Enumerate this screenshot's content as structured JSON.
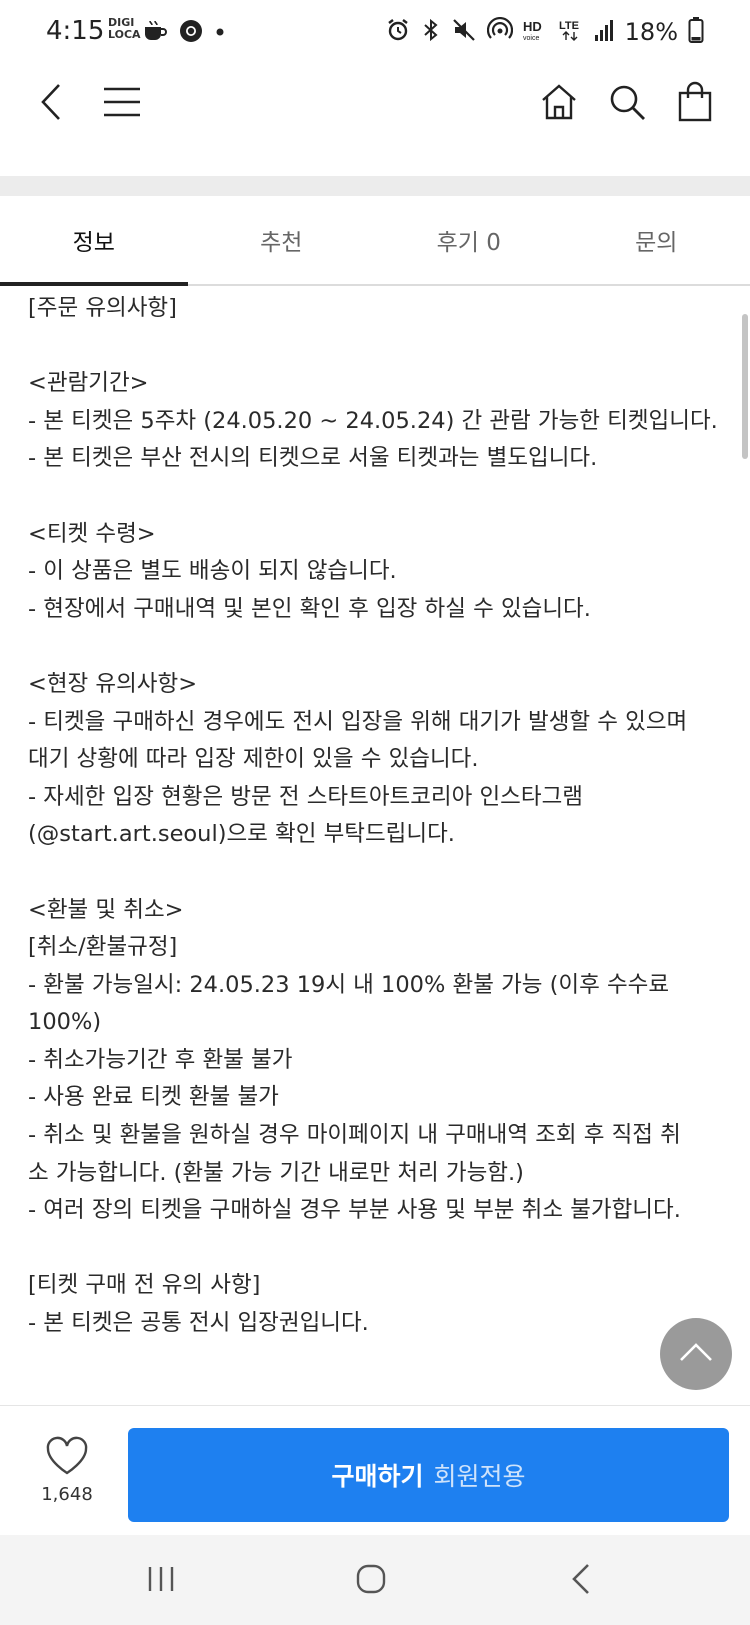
{
  "status_bar": {
    "time": "4:15",
    "app_badge": "DIGI LOCA",
    "battery_text": "18%",
    "icons": [
      "coffee-icon",
      "chrome-icon",
      "dot-icon",
      "alarm-icon",
      "bluetooth-icon",
      "mute-icon",
      "hotspot-icon",
      "hd-voice-icon",
      "lte-icon",
      "signal-icon",
      "battery-icon"
    ]
  },
  "top_nav": {
    "icons": [
      "back-icon",
      "menu-icon",
      "home-icon",
      "search-icon",
      "bag-icon"
    ]
  },
  "tabs": [
    {
      "label": "정보",
      "active": true
    },
    {
      "label": "추천",
      "active": false
    },
    {
      "label": "후기 0",
      "active": false
    },
    {
      "label": "문의",
      "active": false
    }
  ],
  "content": {
    "lines": [
      "[주문 유의사항]",
      "",
      "<관람기간>",
      "- 본 티켓은 5주차 (24.05.20 ~ 24.05.24) 간 관람 가능한 티켓입니다.",
      "- 본 티켓은 부산 전시의 티켓으로 서울 티켓과는 별도입니다.",
      "",
      "<티켓 수령>",
      "- 이 상품은 별도 배송이 되지 않습니다.",
      "- 현장에서 구매내역 및 본인 확인 후 입장 하실 수 있습니다.",
      "",
      "<현장 유의사항>",
      "- 티켓을 구매하신 경우에도 전시 입장을 위해 대기가 발생할 수 있으며",
      "대기 상황에 따라 입장 제한이 있을 수 있습니다.",
      "- 자세한 입장 현황은 방문 전 스타트아트코리아 인스타그램",
      "(@start.art.seoul)으로 확인 부탁드립니다.",
      "",
      "<환불 및 취소>",
      "[취소/환불규정]",
      "- 환불 가능일시: 24.05.23 19시 내 100% 환불 가능 (이후 수수료",
      "100%)",
      "- 취소가능기간 후 환불 불가",
      "- 사용 완료 티켓 환불 불가",
      "- 취소 및 환불을 원하실 경우 마이페이지 내 구매내역 조회 후 직접 취",
      "소 가능합니다. (환불 가능 기간 내로만 처리 가능함.)",
      "- 여러 장의 티켓을 구매하실 경우 부분 사용 및 부분 취소 불가합니다.",
      "",
      "[티켓 구매 전 유의 사항]",
      "- 본 티켓은 공통 전시 입장권입니다."
    ]
  },
  "bottom_bar": {
    "like_count": "1,648",
    "buy_label": "구매하기",
    "buy_sublabel": "회원전용"
  },
  "colors": {
    "accent": "#1e80f0",
    "tab_active": "#222222"
  }
}
